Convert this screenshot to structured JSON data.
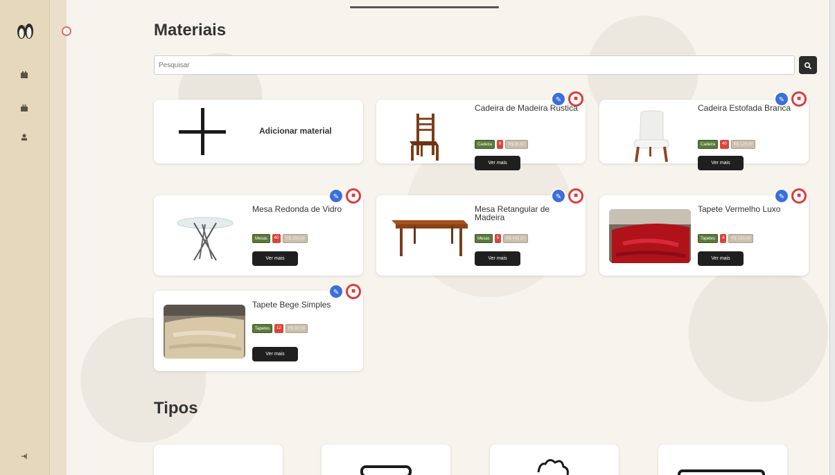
{
  "page": {
    "materials_title": "Materiais",
    "types_title": "Tipos"
  },
  "search": {
    "placeholder": "Pesquisar",
    "button_icon": "search-icon"
  },
  "sidebar": {
    "logo_icon": "penguins-logo",
    "items": [
      {
        "icon": "calendar-icon"
      },
      {
        "icon": "briefcase-icon"
      },
      {
        "icon": "user-icon"
      }
    ],
    "logout_icon": "logout-icon"
  },
  "add_card": {
    "label": "Adicionar material"
  },
  "materials": [
    {
      "name": "Cadeira de Madeira Rústica",
      "type": "Cadeira",
      "qty": "6",
      "price": "R$ 85,00"
    },
    {
      "name": "Cadeira Estofada Branca",
      "type": "Cadeira",
      "qty": "40",
      "price": "R$ 120,00"
    },
    {
      "name": "Mesa Redonda de Vidro",
      "type": "Mesas",
      "qty": "40",
      "price": "R$ 250,00"
    },
    {
      "name": "Mesa Retangular de Madeira",
      "type": "Mesas",
      "qty": "5",
      "price": "R$ 430,00"
    },
    {
      "name": "Tapete Vermelho Luxo",
      "type": "Tapetes",
      "qty": "4",
      "price": "R$ 150,00"
    },
    {
      "name": "Tapete Bege Simples",
      "type": "Tapetes",
      "qty": "12",
      "price": "R$ 90,00"
    }
  ],
  "more_label": "Ver mais",
  "colors": {
    "sidebar": "#e6d8bd",
    "type_badge": "#5a7a3a",
    "qty_badge": "#d9453a",
    "edit_button": "#3a6fdc",
    "delete_button": "#e03a3a",
    "dark_button": "#1f1f1f"
  }
}
